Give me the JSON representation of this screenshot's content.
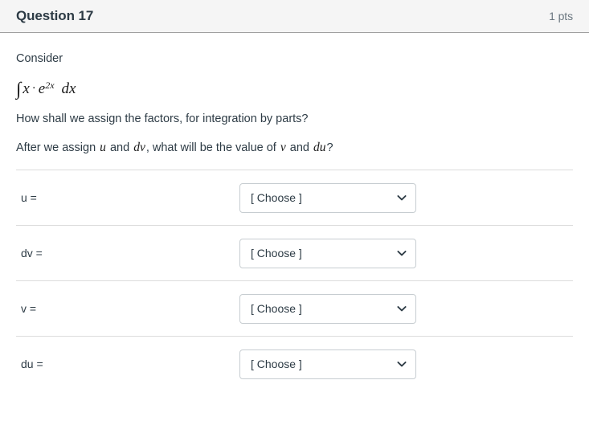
{
  "header": {
    "question_name": "Question 17",
    "points": "1 pts"
  },
  "body": {
    "consider_label": "Consider",
    "integral": {
      "integral_sign": "∫",
      "base": "x",
      "multiply_dot": "·",
      "exponential_base": "e",
      "exponent": "2x",
      "differential": "dx"
    },
    "question_line": "How shall we assign the factors, for integration by parts?",
    "assign_line": {
      "part1": "After we assign",
      "var_u": "u",
      "and1": "and",
      "var_dv": "dv",
      "part2": ", what will be the value of",
      "var_v": "v",
      "and2": "and",
      "var_du": "du",
      "part3": "?"
    }
  },
  "answers": {
    "placeholder": "[ Choose ]",
    "rows": [
      {
        "label": "u =",
        "value": "[ Choose ]"
      },
      {
        "label": "dv =",
        "value": "[ Choose ]"
      },
      {
        "label": "v =",
        "value": "[ Choose ]"
      },
      {
        "label": "du =",
        "value": "[ Choose ]"
      }
    ]
  },
  "colors": {
    "header_bg": "#f5f5f5",
    "header_border": "#a0a0a0",
    "text": "#2d3b45",
    "muted_text": "#6b7780",
    "divider": "#dcdcdc",
    "select_border": "#c7cdd1"
  }
}
